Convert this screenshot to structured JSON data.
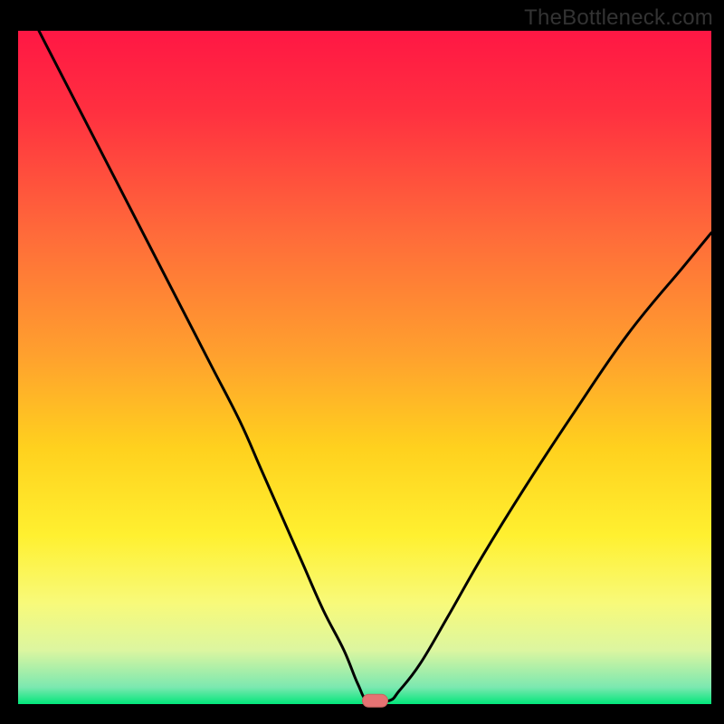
{
  "watermark": "TheBottleneck.com",
  "colors": {
    "frame": "#000000",
    "gradient_stops": [
      {
        "offset": 0.0,
        "color": "#ff1744"
      },
      {
        "offset": 0.12,
        "color": "#ff3040"
      },
      {
        "offset": 0.3,
        "color": "#ff6a3a"
      },
      {
        "offset": 0.48,
        "color": "#ffa02e"
      },
      {
        "offset": 0.62,
        "color": "#ffd11e"
      },
      {
        "offset": 0.75,
        "color": "#fff030"
      },
      {
        "offset": 0.85,
        "color": "#f8fa7a"
      },
      {
        "offset": 0.92,
        "color": "#dcf6a0"
      },
      {
        "offset": 0.975,
        "color": "#7be8b0"
      },
      {
        "offset": 1.0,
        "color": "#02e67a"
      }
    ],
    "curve": "#000000",
    "marker_fill": "#e57373",
    "marker_stroke": "#c76560"
  },
  "chart_data": {
    "type": "line",
    "title": "",
    "xlabel": "",
    "ylabel": "",
    "xlim": [
      0,
      100
    ],
    "ylim": [
      0,
      100
    ],
    "series": [
      {
        "name": "bottleneck-curve",
        "x": [
          3,
          4,
          8,
          12,
          16,
          20,
          24,
          28,
          32,
          35,
          38,
          41,
          44,
          47,
          49,
          50.5,
          53.5,
          55,
          58,
          62,
          67,
          73,
          80,
          88,
          96,
          100
        ],
        "values": [
          100,
          98,
          90,
          82,
          74,
          66,
          58,
          50,
          42,
          35,
          28,
          21,
          14,
          8,
          3,
          0.5,
          0.5,
          2,
          6,
          13,
          22,
          32,
          43,
          55,
          65,
          70
        ]
      }
    ],
    "annotations": [
      {
        "name": "minimum-marker",
        "x": 51.5,
        "y": 0.5
      }
    ]
  }
}
